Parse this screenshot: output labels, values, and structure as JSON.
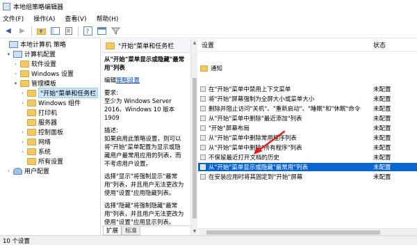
{
  "window": {
    "title": "本地组策略编辑器"
  },
  "menu": [
    "文件(F)",
    "操作(A)",
    "查看(V)",
    "帮助(H)"
  ],
  "tree": [
    {
      "label": "本地计算机 策略",
      "icon": "computer-icon",
      "chev": ""
    },
    {
      "label": "计算机配置",
      "icon": "computer-icon",
      "chev": "▾"
    },
    {
      "label": "软件设置",
      "icon": "folder-icon",
      "chev": "›"
    },
    {
      "label": "Windows 设置",
      "icon": "folder-icon",
      "chev": "›"
    },
    {
      "label": "管理模板",
      "icon": "folder-icon",
      "chev": "▾"
    },
    {
      "label": "\"开始\"菜单和任务栏",
      "icon": "folder-icon",
      "chev": "›",
      "selected": true
    },
    {
      "label": "Windows 组件",
      "icon": "folder-icon",
      "chev": "›"
    },
    {
      "label": "打印机",
      "icon": "folder-icon",
      "chev": ""
    },
    {
      "label": "服务器",
      "icon": "folder-icon",
      "chev": ""
    },
    {
      "label": "控制面板",
      "icon": "folder-icon",
      "chev": "›"
    },
    {
      "label": "网络",
      "icon": "folder-icon",
      "chev": "›"
    },
    {
      "label": "系统",
      "icon": "folder-icon",
      "chev": "›"
    },
    {
      "label": "所有设置",
      "icon": "folder-icon",
      "chev": ""
    },
    {
      "label": "用户配置",
      "icon": "user-icon",
      "chev": "›"
    }
  ],
  "description": {
    "header": "\"开始\"菜单和任务栏",
    "policy_title": "从\"开始\"菜单显示或隐藏\"最常用\"列表",
    "edit_prefix": "编辑",
    "edit_link": "策略设置",
    "req_label": "要求:",
    "req_text": "至少为 Windows Server 2016、Windows 10 版本 1909",
    "desc_label": "描述:",
    "desc_text1": "如果启用此策略设置，则可以将\"开始\"菜单配置为显示或隐藏用户最常用应用的列表，而不考虑用户设置。",
    "desc_text2": "选择\"显示\"将强制显示\"最常用\"列表，并且用户无法更改为使用\"设置\"应用隐藏列表。",
    "desc_text3": "选择\"隐藏\"将强制隐藏\"最常用\"列表，并且用户无法更改为使用\"设置\"应用显示列表。"
  },
  "tabs": [
    "扩展",
    "标准"
  ],
  "settings": {
    "col_setting": "设置",
    "col_state": "状态",
    "rows": [
      {
        "name": "通知",
        "state": "",
        "folder": true
      },
      {
        "name": "在\"开始\"菜单中禁用上下文菜单",
        "state": "未配置"
      },
      {
        "name": "将\"开始\"屏幕强制为全屏大小或菜单大小",
        "state": "未配置"
      },
      {
        "name": "删除并阻止访问\"关机\"、\"重新启动\"、\"睡眠\"和\"休眠\"命令",
        "state": "未配置"
      },
      {
        "name": "从\"开始\"菜单中删除\"最近添加\"列表",
        "state": "未配置"
      },
      {
        "name": "\"开始\"屏幕布局",
        "state": "未配置"
      },
      {
        "name": "从\"开始\"菜单中删除常用程序列表",
        "state": "未配置"
      },
      {
        "name": "从\"开始\"菜单中删除\"所有程序\"列表",
        "state": "未配置"
      },
      {
        "name": "不保留最近打开文档的历史",
        "state": "未配置"
      },
      {
        "name": "从\"开始\"菜单显示或隐藏\"最常用\"列表",
        "state": "未配置",
        "selected": true
      },
      {
        "name": "在安装应用时将其固定到\"开始\"屏幕",
        "state": "未配置"
      }
    ]
  },
  "status": {
    "text": "10 个设置"
  },
  "colors": {
    "selection": "#0a64d0",
    "annotation_arrow": "#e02020"
  }
}
